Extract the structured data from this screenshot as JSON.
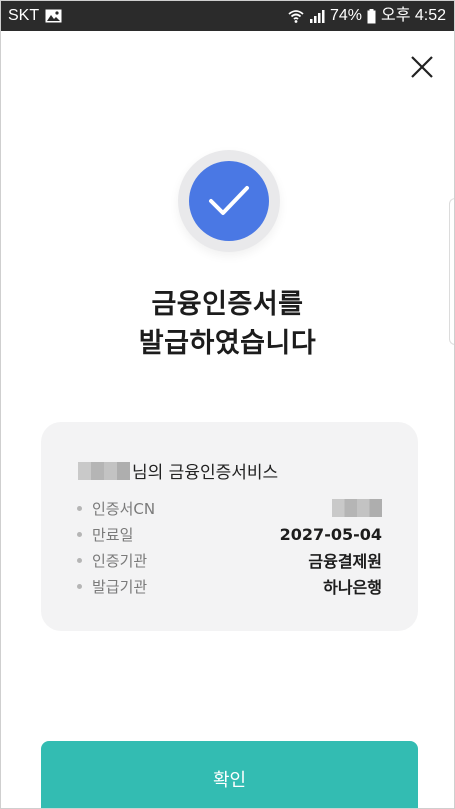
{
  "status_bar": {
    "carrier": "SKT",
    "battery_percent": "74%",
    "time": "오후 4:52",
    "icons": [
      "image-notification-icon",
      "wifi-icon",
      "signal-icon",
      "battery-icon"
    ]
  },
  "header": {
    "close_icon": "close-icon"
  },
  "result": {
    "icon": "check-icon",
    "accent_color": "#4a78e4",
    "title_line1": "금융인증서를",
    "title_line2": "발급하였습니다"
  },
  "card": {
    "owner_suffix": "님의 금융인증서비스",
    "rows": [
      {
        "label": "인증서CN",
        "value": ""
      },
      {
        "label": "만료일",
        "value": "2027-05-04"
      },
      {
        "label": "인증기관",
        "value": "금융결제원"
      },
      {
        "label": "발급기관",
        "value": "하나은행"
      }
    ]
  },
  "footer": {
    "confirm_label": "확인",
    "confirm_color": "#33bcb2"
  }
}
